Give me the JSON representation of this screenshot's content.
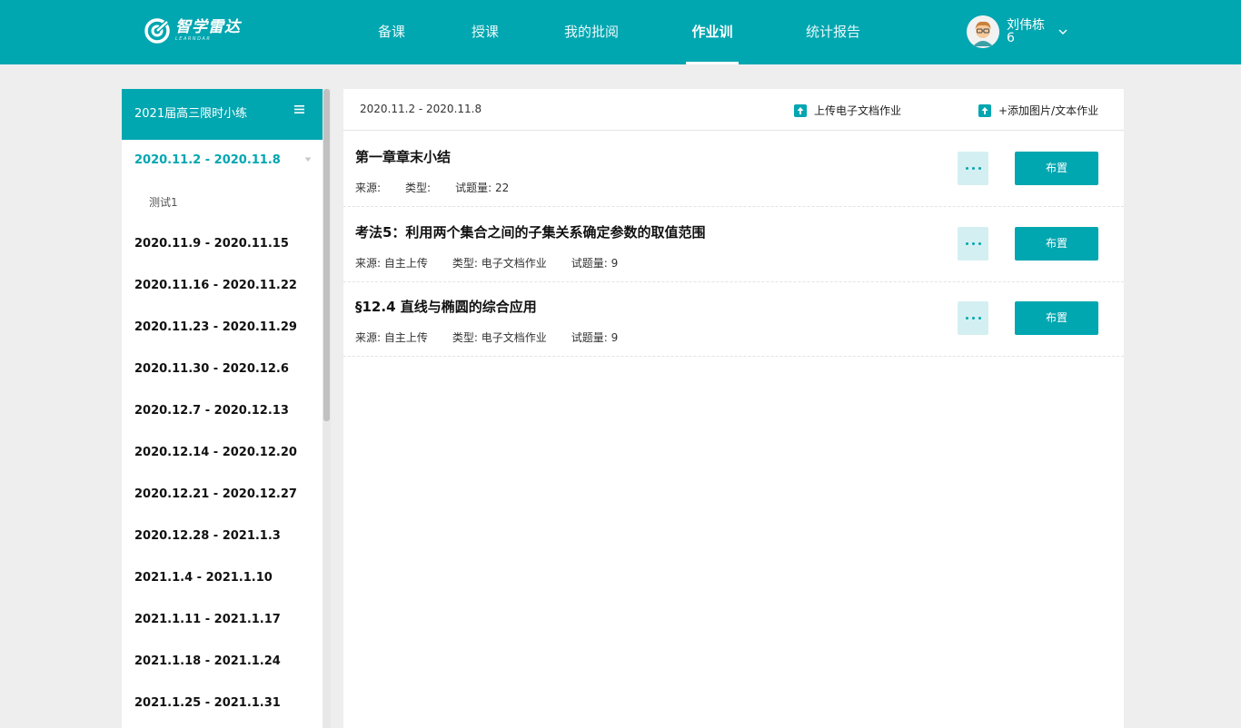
{
  "brand": {
    "name_cn": "智学雷达",
    "name_en": "LEARNDAR"
  },
  "colors": {
    "accent": "#00a6b0",
    "accent_light": "#d4eff1",
    "background": "#eeeeee"
  },
  "nav": {
    "items": [
      {
        "label": "备课",
        "active": false
      },
      {
        "label": "授课",
        "active": false
      },
      {
        "label": "我的批阅",
        "active": false
      },
      {
        "label": "作业训练",
        "active": true
      },
      {
        "label": "统计报告",
        "active": false
      }
    ]
  },
  "user": {
    "name": "刘伟栋",
    "sub": "6",
    "avatar_icon": "avatar-icon",
    "caret_icon": "chevron-down-icon"
  },
  "sidebar": {
    "title": "2021届高三限时小练",
    "menu_icon": "menu-icon",
    "weeks": [
      {
        "label": "2020.11.2 - 2020.11.8",
        "active": true,
        "children": [
          {
            "label": "测试1"
          }
        ]
      },
      {
        "label": "2020.11.9 - 2020.11.15"
      },
      {
        "label": "2020.11.16 - 2020.11.22"
      },
      {
        "label": "2020.11.23 - 2020.11.29"
      },
      {
        "label": "2020.11.30 - 2020.12.6"
      },
      {
        "label": "2020.12.7 - 2020.12.13"
      },
      {
        "label": "2020.12.14 - 2020.12.20"
      },
      {
        "label": "2020.12.21 - 2020.12.27"
      },
      {
        "label": "2020.12.28 - 2021.1.3"
      },
      {
        "label": "2021.1.4 - 2021.1.10"
      },
      {
        "label": "2021.1.11 - 2021.1.17"
      },
      {
        "label": "2021.1.18 - 2021.1.24"
      },
      {
        "label": "2021.1.25 - 2021.1.31"
      }
    ]
  },
  "main": {
    "range": "2020.11.2 - 2020.11.8",
    "upload_doc": "上传电子文档作业",
    "add_image_text": "+添加图片/文本作业",
    "assign_label": "布置",
    "tasks": [
      {
        "title": "第一章章末小结",
        "source": "来源: ",
        "type": "类型: ",
        "count": "试题量: 22"
      },
      {
        "title": "考法5：利用两个集合之间的子集关系确定参数的取值范围",
        "source": "来源: 自主上传",
        "type": "类型: 电子文档作业",
        "count": "试题量: 9"
      },
      {
        "title": "§12.4 直线与椭圆的综合应用",
        "source": "来源: 自主上传",
        "type": "类型: 电子文档作业",
        "count": "试题量: 9"
      }
    ]
  }
}
